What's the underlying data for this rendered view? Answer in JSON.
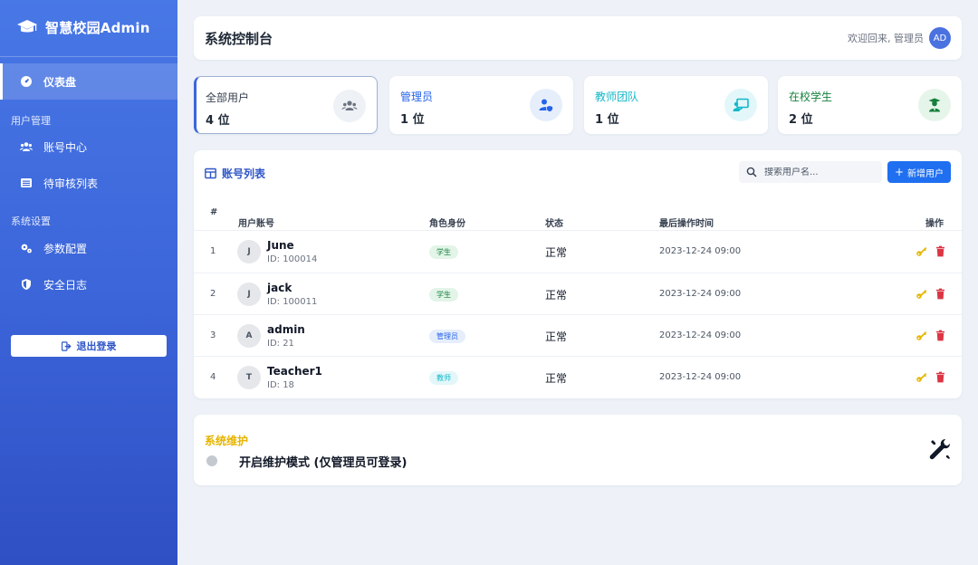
{
  "sidebar": {
    "brand": "智慧校园Admin",
    "items": [
      {
        "label": "仪表盘"
      },
      {
        "label": "账号中心"
      },
      {
        "label": "待审核列表"
      },
      {
        "label": "参数配置"
      },
      {
        "label": "安全日志"
      }
    ],
    "groups": [
      "用户管理",
      "系统设置"
    ],
    "logout_label": "退出登录"
  },
  "header": {
    "title": "系统控制台",
    "welcome": "欢迎回来, 管理员",
    "avatar_initials": "AD"
  },
  "stats": [
    {
      "label": "全部用户",
      "value": "4 位",
      "color": "#374151",
      "icon": "users-icon"
    },
    {
      "label": "管理员",
      "value": "1 位",
      "color": "#2563eb",
      "icon": "user-shield-icon"
    },
    {
      "label": "教师团队",
      "value": "1 位",
      "color": "#14b8c9",
      "icon": "chalkboard-teacher-icon"
    },
    {
      "label": "在校学生",
      "value": "2 位",
      "color": "#15803d",
      "icon": "user-graduate-icon"
    }
  ],
  "table": {
    "title": "账号列表",
    "search_placeholder": "搜索用户名...",
    "add_label": "新增用户",
    "columns": [
      "#",
      "用户账号",
      "角色身份",
      "状态",
      "最后操作时间",
      "操作"
    ],
    "rows": [
      {
        "idx": "1",
        "initial": "J",
        "name": "June",
        "id": "ID: 100014",
        "role": "学生",
        "status": "正常",
        "time": "2023-12-24 09:00"
      },
      {
        "idx": "2",
        "initial": "J",
        "name": "jack",
        "id": "ID: 100011",
        "role": "学生",
        "status": "正常",
        "time": "2023-12-24 09:00"
      },
      {
        "idx": "3",
        "initial": "A",
        "name": "admin",
        "id": "ID: 21",
        "role": "管理员",
        "status": "正常",
        "time": "2023-12-24 09:00"
      },
      {
        "idx": "4",
        "initial": "T",
        "name": "Teacher1",
        "id": "ID: 18",
        "role": "教师",
        "status": "正常",
        "time": "2023-12-24 09:00"
      }
    ]
  },
  "maintenance": {
    "title": "系统维护",
    "label": "开启维护模式 (仅管理员可登录)",
    "enabled": false
  },
  "colors": {
    "accent": "#3c66da",
    "primary_button": "#1f6ff0",
    "maintenance_title": "#e5b400",
    "key_icon": "#e6b800",
    "trash_icon": "#dc3545"
  }
}
